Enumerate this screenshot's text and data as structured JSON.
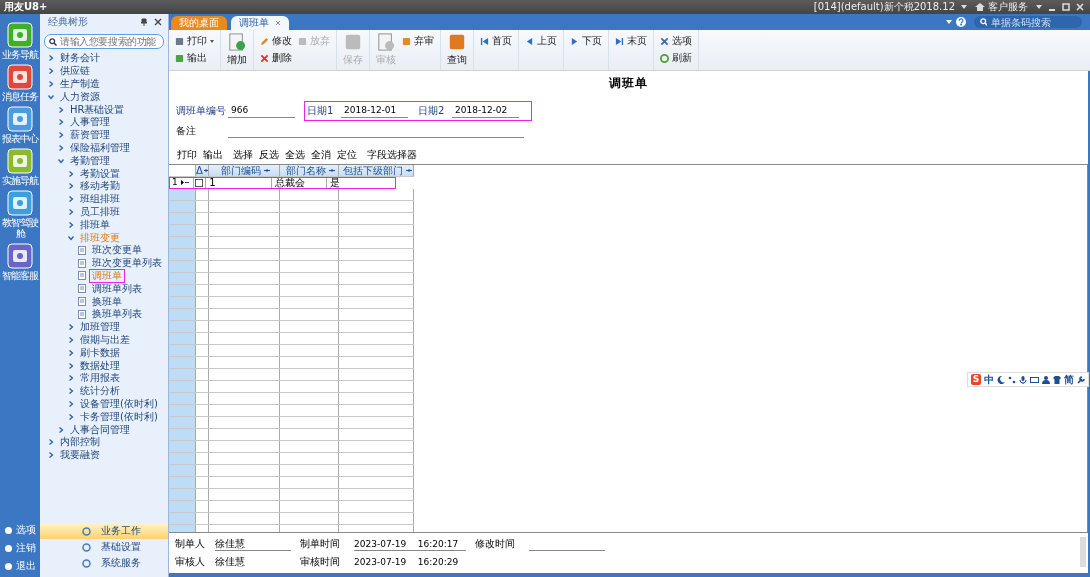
{
  "title_bar": {
    "logo": "用友U8+",
    "account": "[014](default)新个税2018.12",
    "service": "客户服务"
  },
  "left_nav": {
    "items": [
      {
        "label": "业务导航"
      },
      {
        "label": "消息任务"
      },
      {
        "label": "报表中心"
      },
      {
        "label": "实施导航"
      },
      {
        "label": "教智驾驶舱"
      },
      {
        "label": "智能客服"
      }
    ],
    "bottom_items": [
      {
        "label": "选项"
      },
      {
        "label": "注销"
      },
      {
        "label": "退出"
      }
    ]
  },
  "tree_panel": {
    "title": "经典树形",
    "search": {
      "placeholder": "请输入您要搜索的功能"
    },
    "items": [
      {
        "label": "财务会计",
        "kind": "folder",
        "expanded": false,
        "selected": false,
        "highlighted": false
      },
      {
        "label": "供应链",
        "kind": "folder",
        "expanded": false,
        "selected": false,
        "highlighted": false
      },
      {
        "label": "生产制造",
        "kind": "folder",
        "expanded": false,
        "selected": false,
        "highlighted": false
      },
      {
        "label": "人力资源",
        "kind": "folder",
        "expanded": true,
        "selected": false,
        "highlighted": false,
        "children": [
          {
            "label": "HR基础设置",
            "kind": "folder",
            "expanded": false,
            "selected": false,
            "highlighted": false
          },
          {
            "label": "人事管理",
            "kind": "folder",
            "expanded": false,
            "selected": false,
            "highlighted": false
          },
          {
            "label": "薪资管理",
            "kind": "folder",
            "expanded": false,
            "selected": false,
            "highlighted": false
          },
          {
            "label": "保险福利管理",
            "kind": "folder",
            "expanded": false,
            "selected": false,
            "highlighted": false
          },
          {
            "label": "考勤管理",
            "kind": "folder",
            "expanded": true,
            "selected": false,
            "highlighted": false,
            "children": [
              {
                "label": "考勤设置",
                "kind": "folder",
                "expanded": false,
                "selected": false,
                "highlighted": false
              },
              {
                "label": "移动考勤",
                "kind": "folder",
                "expanded": false,
                "selected": false,
                "highlighted": false
              },
              {
                "label": "班组排班",
                "kind": "folder",
                "expanded": false,
                "selected": false,
                "highlighted": false
              },
              {
                "label": "员工排班",
                "kind": "folder",
                "expanded": false,
                "selected": false,
                "highlighted": false
              },
              {
                "label": "排班单",
                "kind": "folder",
                "expanded": false,
                "selected": false,
                "highlighted": false
              },
              {
                "label": "排班变更",
                "kind": "folder",
                "expanded": true,
                "selected": true,
                "highlighted": false,
                "children": [
                  {
                    "label": "班次变更单",
                    "kind": "document",
                    "selected": false,
                    "highlighted": false
                  },
                  {
                    "label": "班次变更单列表",
                    "kind": "document",
                    "selected": false,
                    "highlighted": false
                  },
                  {
                    "label": "调班单",
                    "kind": "document",
                    "selected": true,
                    "highlighted": true
                  },
                  {
                    "label": "调班单列表",
                    "kind": "document",
                    "selected": false,
                    "highlighted": false
                  },
                  {
                    "label": "换班单",
                    "kind": "document",
                    "selected": false,
                    "highlighted": false
                  },
                  {
                    "label": "换班单列表",
                    "kind": "document",
                    "selected": false,
                    "highlighted": false
                  }
                ]
              },
              {
                "label": "加班管理",
                "kind": "folder",
                "expanded": false,
                "selected": false,
                "highlighted": false
              },
              {
                "label": "假期与出差",
                "kind": "folder",
                "expanded": false,
                "selected": false,
                "highlighted": false
              },
              {
                "label": "刷卡数据",
                "kind": "folder",
                "expanded": false,
                "selected": false,
                "highlighted": false
              },
              {
                "label": "数据处理",
                "kind": "folder",
                "expanded": false,
                "selected": false,
                "highlighted": false
              },
              {
                "label": "常用报表",
                "kind": "folder",
                "expanded": false,
                "selected": false,
                "highlighted": false
              },
              {
                "label": "统计分析",
                "kind": "folder",
                "expanded": false,
                "selected": false,
                "highlighted": false
              },
              {
                "label": "设备管理(依时利)",
                "kind": "folder",
                "expanded": false,
                "selected": false,
                "highlighted": false
              },
              {
                "label": "卡务管理(依时利)",
                "kind": "folder",
                "expanded": false,
                "selected": false,
                "highlighted": false
              }
            ]
          },
          {
            "label": "人事合同管理",
            "kind": "folder",
            "expanded": false,
            "selected": false,
            "highlighted": false
          }
        ]
      },
      {
        "label": "内部控制",
        "kind": "folder",
        "expanded": false,
        "selected": false,
        "highlighted": false
      },
      {
        "label": "我要融资",
        "kind": "folder",
        "expanded": false,
        "selected": false,
        "highlighted": false
      }
    ],
    "sections": [
      {
        "label": "业务工作",
        "selected": true
      },
      {
        "label": "基础设置",
        "selected": false
      },
      {
        "label": "系统服务",
        "selected": false
      }
    ]
  },
  "tabs": [
    {
      "label": "我的桌面",
      "selected": false,
      "closable": false
    },
    {
      "label": "调班单",
      "selected": true,
      "closable": true
    }
  ],
  "barcode_search": {
    "placeholder": "单据条码搜索"
  },
  "toolbar": [
    {
      "items": [
        {
          "label": "打印",
          "kind": "small",
          "disabled": false,
          "dropdown": true
        },
        {
          "label": "输出",
          "kind": "small",
          "disabled": false,
          "dropdown": false
        }
      ]
    },
    {
      "items": [
        {
          "label": "增加",
          "kind": "large",
          "disabled": false,
          "dropdown": false
        }
      ]
    },
    {
      "items": [
        {
          "label": "修改",
          "kind": "small",
          "disabled": false,
          "dropdown": false
        },
        {
          "label": "删除",
          "kind": "small",
          "disabled": false,
          "dropdown": false
        },
        {
          "label": "放弃",
          "kind": "small",
          "disabled": true,
          "dropdown": false
        }
      ]
    },
    {
      "items": [
        {
          "label": "保存",
          "kind": "large",
          "disabled": true,
          "dropdown": false
        }
      ]
    },
    {
      "items": [
        {
          "label": "审核",
          "kind": "large",
          "disabled": true,
          "dropdown": false
        },
        {
          "label": "弃审",
          "kind": "small",
          "disabled": false,
          "dropdown": false
        }
      ]
    },
    {
      "items": [
        {
          "label": "查询",
          "kind": "large",
          "disabled": false,
          "dropdown": false
        }
      ]
    },
    {
      "items": [
        {
          "label": "首页",
          "kind": "small",
          "disabled": false,
          "dropdown": false
        }
      ]
    },
    {
      "items": [
        {
          "label": "上页",
          "kind": "small",
          "disabled": false,
          "dropdown": false
        }
      ]
    },
    {
      "items": [
        {
          "label": "下页",
          "kind": "small",
          "disabled": false,
          "dropdown": false
        }
      ]
    },
    {
      "items": [
        {
          "label": "末页",
          "kind": "small",
          "disabled": false,
          "dropdown": false
        }
      ]
    },
    {
      "items": [
        {
          "label": "选项",
          "kind": "small",
          "disabled": false,
          "dropdown": false
        },
        {
          "label": "刷新",
          "kind": "small",
          "disabled": false,
          "dropdown": false
        }
      ]
    }
  ],
  "form": {
    "title": "调班单",
    "number_field": {
      "label": "调班单编号",
      "value": "966",
      "required": true
    },
    "date_fields": {
      "highlighted": true,
      "items": [
        {
          "label": "日期1",
          "value": "2018-12-01",
          "required": true
        },
        {
          "label": "日期2",
          "value": "2018-12-02",
          "required": true
        }
      ]
    },
    "note": {
      "label": "备注",
      "required": false
    },
    "grid_toolbar": [
      "打印",
      "输出",
      "选择",
      "反选",
      "全选",
      "全消",
      "定位",
      "字段选择器"
    ],
    "grid": {
      "corner": "Δ",
      "columns": [
        "部门编码",
        "部门名称",
        "包括下级部门"
      ],
      "rows": [
        {
          "number": "1",
          "selected": true,
          "checked": false,
          "highlighted": true,
          "cells": [
            "1",
            "总裁会",
            "是"
          ]
        }
      ]
    },
    "footer": [
      {
        "label": "制单人",
        "value": "徐佳慧"
      },
      {
        "label": "制单时间",
        "value": "2023-07-19    16:20:17"
      },
      {
        "label": "修改时间"
      },
      {
        "label": "审核人",
        "value": "徐佳慧"
      },
      {
        "label": "审核时间",
        "value": "2023-07-19    16:20:29"
      }
    ]
  },
  "ime_bar": {
    "logo": "S",
    "mode": "中",
    "script": "简"
  }
}
